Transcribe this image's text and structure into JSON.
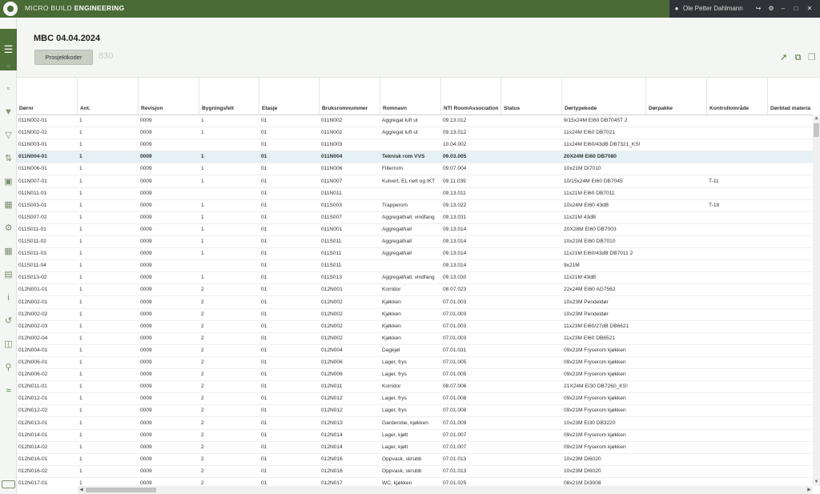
{
  "topbar": {
    "brand_light": "MICRO BUILD ",
    "brand_bold": "ENGINEERING",
    "user_name": "Ole Petter Dahlmann",
    "icons": [
      "user-icon",
      "logout-icon",
      "settings-icon",
      "minimize-icon",
      "maximize-icon",
      "close-icon"
    ]
  },
  "sidebar": {
    "icons": [
      "menu-icon",
      "collapse-icon",
      "document-icon",
      "filter-icon",
      "clear-filter-icon",
      "sort-icon",
      "room-icon",
      "room-add-icon",
      "group-icon",
      "grid-icon",
      "bank-icon",
      "info-icon",
      "undo-icon",
      "excel-icon",
      "search-icon",
      "wifi-icon",
      "keyboard-icon"
    ]
  },
  "header": {
    "title": "MBC 04.04.2024",
    "button_label": "Prosjektkoder",
    "project_number": "830",
    "icons": [
      "open-external-icon",
      "copy-icon",
      "paste-icon"
    ]
  },
  "table": {
    "columns": [
      "Dørnr",
      "Ant.",
      "Revisjon",
      "Bygningsfelt",
      "Etasje",
      "Bruksromnummer",
      "Romnavn",
      "NTI RoomAssociation",
      "Status",
      "Dørtypekode",
      "Dørpakke",
      "Kontrollområde",
      "Dørblad materia"
    ],
    "selected_row": 3,
    "rows": [
      [
        "011N002-01",
        "1",
        "0009",
        "1",
        "01",
        "011N002",
        "Aggregat luft ut",
        "09.13.012",
        "",
        "9/15x24M EI60 DB7045T 2",
        "",
        "",
        ""
      ],
      [
        "011N002-02",
        "1",
        "0009",
        "1",
        "01",
        "011N002",
        "Aggregat luft ut",
        "09.13.012",
        "",
        "11x24M EI60 DB7021",
        "",
        "",
        ""
      ],
      [
        "011N003-01",
        "1",
        "0009",
        "",
        "01",
        "011N003",
        "",
        "10.04.002",
        "",
        "11x24M EI60/43dB DB7321_KS!",
        "",
        "",
        ""
      ],
      [
        "011N004-01",
        "1",
        "0009",
        "1",
        "01",
        "011N004",
        "Teknisk rom VVS",
        "09.03.005",
        "",
        "20X24M EI60 DB7080",
        "",
        "",
        ""
      ],
      [
        "011N006-01",
        "1",
        "0009",
        "1",
        "01",
        "011N006",
        "Filterrom",
        "09.07.004",
        "",
        "10x21M  DI7010",
        "",
        "",
        ""
      ],
      [
        "011N007-01",
        "1",
        "0009",
        "1",
        "01",
        "011N007",
        "Kulvert, EL nett og IKT",
        "09.11.039",
        "",
        "10/15x24M EI60 DB7045",
        "",
        "T-11",
        ""
      ],
      [
        "011N011-01",
        "1",
        "0009",
        "",
        "01",
        "011N011",
        "",
        "09.13.011",
        "",
        "11x21M EI60 DB7011",
        "",
        "",
        ""
      ],
      [
        "011S003-01",
        "1",
        "0009",
        "1",
        "01",
        "011S003",
        "Trapperom",
        "09.13.022",
        "",
        "10x24M EI60 43dB",
        "",
        "T-18",
        ""
      ],
      [
        "011S007-02",
        "1",
        "0009",
        "1",
        "01",
        "011S007",
        "Aggregathall, vindfang",
        "09.13.031",
        "",
        "11x21M 43dB",
        "",
        "",
        ""
      ],
      [
        "011S011-01",
        "1",
        "0009",
        "1",
        "01",
        "011N001",
        "Aggregathall",
        "09.13.014",
        "",
        "20X28M EI60 DB7003",
        "",
        "",
        ""
      ],
      [
        "011S011-02",
        "1",
        "0009",
        "1",
        "01",
        "011S011",
        "Aggregathall",
        "09.13.014",
        "",
        "10x21M EI60 DB7010",
        "",
        "",
        ""
      ],
      [
        "011S011-03",
        "1",
        "0009",
        "1",
        "01",
        "011S011",
        "Aggregathall",
        "09.13.014",
        "",
        "11x21M EI60/43dB DB7011 2",
        "",
        "",
        ""
      ],
      [
        "011S011-04",
        "1",
        "0009",
        "",
        "01",
        "011S011",
        "",
        "09.13.014",
        "",
        "9x21M",
        "",
        "",
        ""
      ],
      [
        "011S013-02",
        "1",
        "0009",
        "1",
        "01",
        "011S013",
        "Aggregathall, vindfang",
        "09.13.030",
        "",
        "11x21M 43dB",
        "",
        "",
        ""
      ],
      [
        "012N001-01",
        "1",
        "0009",
        "2",
        "01",
        "012N001",
        "Korridor",
        "08.07.023",
        "",
        "22x24M EI60 AG7562",
        "",
        "",
        ""
      ],
      [
        "012N002-01",
        "1",
        "0009",
        "2",
        "01",
        "012N002",
        "Kjøkken",
        "07.01.003",
        "",
        "10x23M Pendeldør",
        "",
        "",
        ""
      ],
      [
        "012N002-02",
        "1",
        "0009",
        "2",
        "01",
        "012N002",
        "Kjøkken",
        "07.01.003",
        "",
        "10x23M Pendeldør",
        "",
        "",
        ""
      ],
      [
        "012N002-03",
        "1",
        "0009",
        "2",
        "01",
        "012N002",
        "Kjøkken",
        "07.01.003",
        "",
        "11x23M EI60/27dB DB6621",
        "",
        "",
        ""
      ],
      [
        "012N002-04",
        "1",
        "0009",
        "2",
        "01",
        "012N002",
        "Kjøkken",
        "07.01.003",
        "",
        "11x23M EI60 DB6521",
        "",
        "",
        ""
      ],
      [
        "012N004-01",
        "1",
        "0009",
        "2",
        "01",
        "012N004",
        "Dagkjøl",
        "07.01.031",
        "",
        "09x21M Fryserom kjøkken",
        "",
        "",
        ""
      ],
      [
        "012N006-01",
        "1",
        "0009",
        "2",
        "01",
        "012N006",
        "Lager, frys",
        "07.01.005",
        "",
        "09x21M Fryserom kjøkken",
        "",
        "",
        ""
      ],
      [
        "012N006-02",
        "1",
        "0009",
        "2",
        "01",
        "012N006",
        "Lager, frys",
        "07.01.005",
        "",
        "09x21M Fryserom kjøkken",
        "",
        "",
        ""
      ],
      [
        "012N011-01",
        "1",
        "0009",
        "2",
        "01",
        "012N011",
        "Korridor",
        "08.07.006",
        "",
        "21X24M EI30 DB7260_KS!",
        "",
        "",
        ""
      ],
      [
        "012N012-01",
        "1",
        "0009",
        "2",
        "01",
        "012N012",
        "Lager, frys",
        "07.01.008",
        "",
        "09x21M Fryserom kjøkken",
        "",
        "",
        ""
      ],
      [
        "012N012-02",
        "1",
        "0009",
        "2",
        "01",
        "012N012",
        "Lager, frys",
        "07.01.008",
        "",
        "09x21M Fryserom kjøkken",
        "",
        "",
        ""
      ],
      [
        "012N013-01",
        "1",
        "0009",
        "2",
        "01",
        "012N013",
        "Garderobe, kjøkken",
        "07.01.009",
        "",
        "10x23M EI30 DB3220",
        "",
        "",
        ""
      ],
      [
        "012N014-01",
        "1",
        "0009",
        "2",
        "01",
        "012N014",
        "Lager, kjølt",
        "07.01.007",
        "",
        "09x21M Fryserom kjøkken",
        "",
        "",
        ""
      ],
      [
        "012N014-02",
        "1",
        "0009",
        "2",
        "01",
        "012N014",
        "Lager, kjølt",
        "07.01.007",
        "",
        "09x21M Fryserom kjøkken",
        "",
        "",
        ""
      ],
      [
        "012N016-01",
        "1",
        "0009",
        "2",
        "01",
        "012N016",
        "Oppvask, skrubb",
        "07.01.013",
        "",
        "10x23M DI6020",
        "",
        "",
        ""
      ],
      [
        "012N016-02",
        "1",
        "0009",
        "2",
        "01",
        "012N016",
        "Oppvask, skrubb",
        "07.01.013",
        "",
        "10x23M DI6020",
        "",
        "",
        ""
      ],
      [
        "012N017-01",
        "1",
        "0009",
        "2",
        "01",
        "012N017",
        "WC, kjøkken",
        "07.01.025",
        "",
        "08x21M DI3008",
        "",
        "",
        ""
      ]
    ]
  },
  "colors": {
    "brand_green": "#4a6a36",
    "selected_row": "#e6f1f6"
  }
}
